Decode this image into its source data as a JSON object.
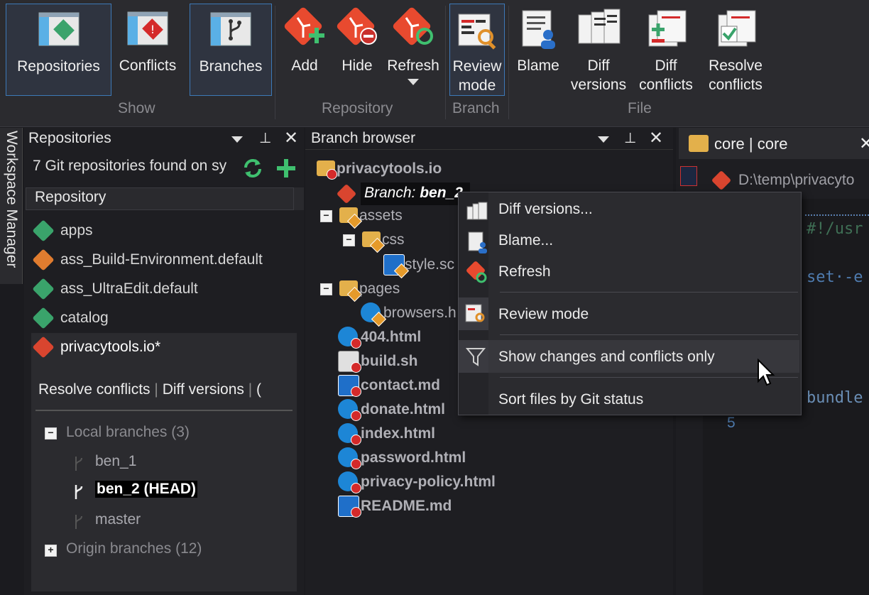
{
  "ribbon": {
    "groups": [
      {
        "label": "Show",
        "buttons": [
          {
            "label": "Repositories"
          },
          {
            "label": "Conflicts"
          },
          {
            "label": "Branches"
          }
        ]
      },
      {
        "label": "Repository",
        "buttons": [
          {
            "label": "Add"
          },
          {
            "label": "Hide"
          },
          {
            "label": "Refresh"
          }
        ]
      },
      {
        "label": "Branch",
        "buttons": [
          {
            "label1": "Review",
            "label2": "mode"
          }
        ]
      },
      {
        "label": "File",
        "buttons": [
          {
            "label": "Blame"
          },
          {
            "label1": "Diff",
            "label2": "versions"
          },
          {
            "label1": "Diff",
            "label2": "conflicts"
          },
          {
            "label1": "Resolve",
            "label2": "conflicts"
          }
        ]
      }
    ]
  },
  "workspace_tab": "Workspace Manager",
  "repositories_panel": {
    "title": "Repositories",
    "status": "7 Git repositories found on sy",
    "column_header": "Repository",
    "items": [
      {
        "name": "apps",
        "color": "#3aa36b"
      },
      {
        "name": "ass_Build-Environment.default",
        "color": "#e07c2f"
      },
      {
        "name": "ass_UltraEdit.default",
        "color": "#3aa36b"
      },
      {
        "name": "catalog",
        "color": "#3aa36b"
      },
      {
        "name": "privacytools.io*",
        "color": "#d9452f"
      }
    ],
    "detail_links": {
      "resolve": "Resolve conflicts",
      "sep": "|",
      "diff": "Diff versions",
      "sep2": "|",
      "more": "("
    },
    "local_branches_label": "Local branches (3)",
    "local_branches": [
      "ben_1",
      "ben_2 (HEAD)",
      "master"
    ],
    "origin_branches_label": "Origin branches (12)"
  },
  "branch_browser": {
    "title": "Branch browser",
    "root": "privacytools.io",
    "branch_prefix": "Branch: ",
    "branch_name": "ben_2",
    "folders": {
      "assets": "assets",
      "css": "css",
      "style": "style.sc",
      "pages": "pages",
      "browsers": "browsers.h"
    },
    "files": [
      "404.html",
      "build.sh",
      "contact.md",
      "donate.html",
      "index.html",
      "password.html",
      "privacy-policy.html",
      "README.md"
    ]
  },
  "editor": {
    "tab": "core | core",
    "path": "D:\\temp\\privacyto",
    "code_lines": [
      "#!/usr",
      "set·-e",
      "bundle"
    ],
    "line_number": "5"
  },
  "context_menu": {
    "items": [
      "Diff versions...",
      "Blame...",
      "Refresh",
      "Review mode",
      "Show changes and conflicts only",
      "Sort files by Git status"
    ]
  },
  "colors": {
    "accent": "#3d79b8",
    "git_red": "#d9452f",
    "git_green": "#3aa36b",
    "git_orange": "#e07c2f",
    "background": "#1b1b1f"
  }
}
